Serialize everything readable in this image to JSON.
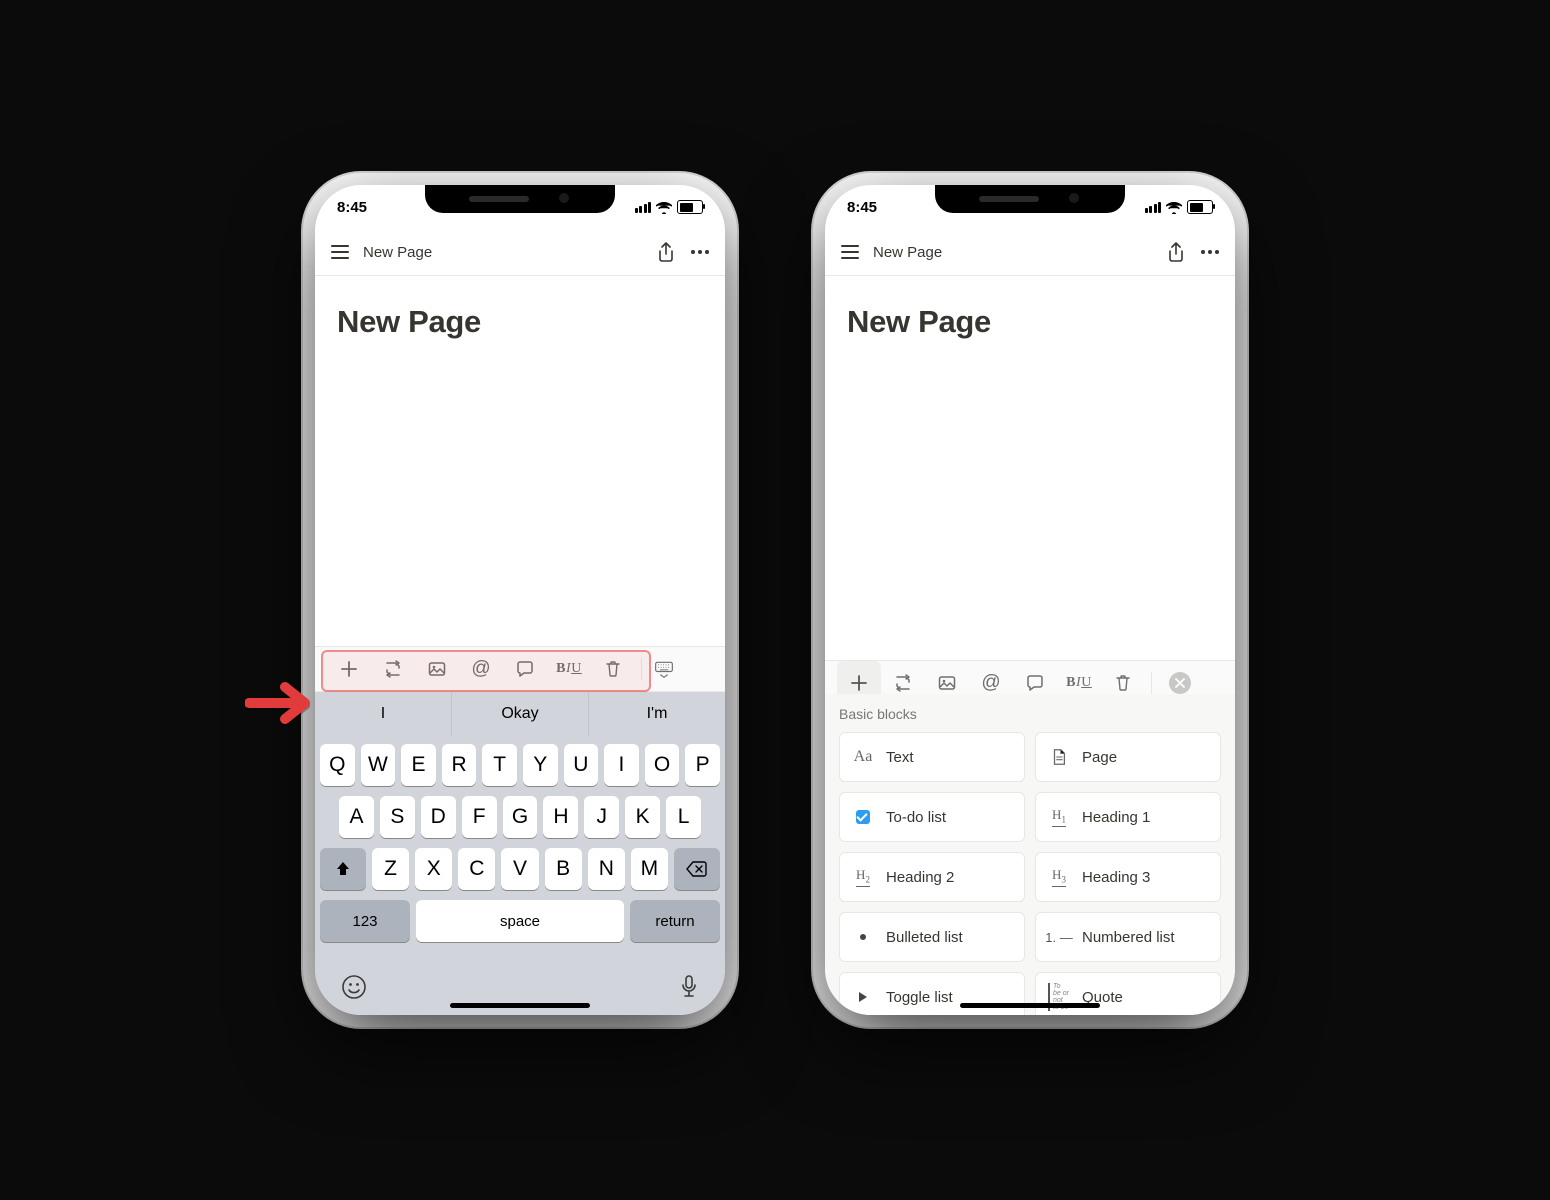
{
  "status": {
    "time": "8:45"
  },
  "nav": {
    "breadcrumb": "New Page"
  },
  "title": "New Page",
  "toolbar": {
    "at_glyph": "@",
    "biu": {
      "b": "B",
      "i": "I",
      "u": "U"
    }
  },
  "keyboard": {
    "suggestions": [
      "I",
      "Okay",
      "I'm"
    ],
    "row1": [
      "Q",
      "W",
      "E",
      "R",
      "T",
      "Y",
      "U",
      "I",
      "O",
      "P"
    ],
    "row2": [
      "A",
      "S",
      "D",
      "F",
      "G",
      "H",
      "J",
      "K",
      "L"
    ],
    "row3": [
      "Z",
      "X",
      "C",
      "V",
      "B",
      "N",
      "M"
    ],
    "num_label": "123",
    "space_label": "space",
    "return_label": "return"
  },
  "panel": {
    "section_title": "Basic blocks",
    "blocks": [
      {
        "label": "Text"
      },
      {
        "label": "Page"
      },
      {
        "label": "To-do list"
      },
      {
        "label": "Heading 1"
      },
      {
        "label": "Heading 2"
      },
      {
        "label": "Heading 3"
      },
      {
        "label": "Bulleted list"
      },
      {
        "label": "Numbered list"
      },
      {
        "label": "Toggle list"
      },
      {
        "label": "Quote"
      }
    ],
    "quote_placeholder": "To be\nor not\nto be"
  }
}
